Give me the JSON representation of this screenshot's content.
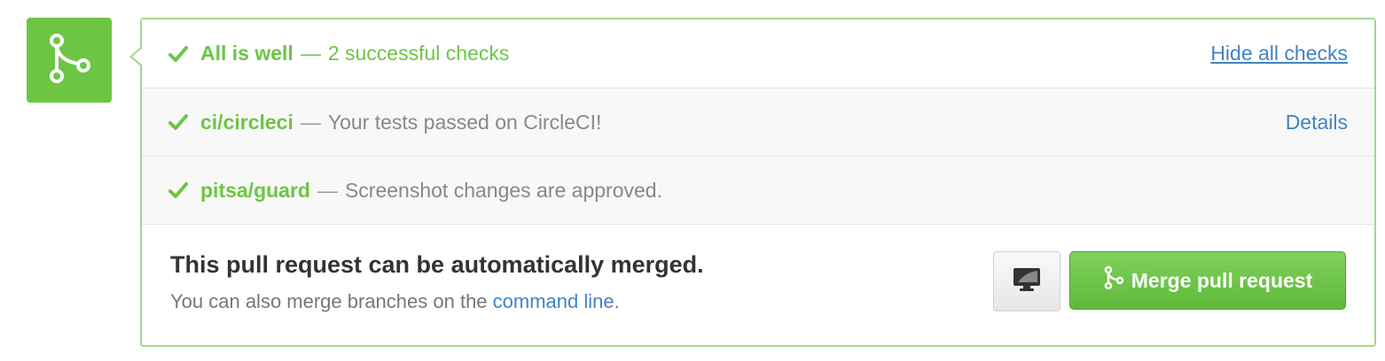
{
  "summary": {
    "headline": "All is well",
    "separator": "—",
    "count_text": "2 successful checks",
    "toggle_link": "Hide all checks"
  },
  "checks": [
    {
      "name": "ci/circleci",
      "separator": "—",
      "description": "Your tests passed on CircleCI!",
      "link": "Details"
    },
    {
      "name": "pitsa/guard",
      "separator": "—",
      "description": "Screenshot changes are approved.",
      "link": ""
    }
  ],
  "merge": {
    "title": "This pull request can be automatically merged.",
    "sub_prefix": "You can also merge branches on the ",
    "sub_link": "command line",
    "sub_suffix": ".",
    "button_label": "Merge pull request"
  },
  "icons": {
    "status": "merge-icon",
    "check": "checkmark-icon",
    "monitor": "desktop-monitor-icon"
  },
  "colors": {
    "success_green": "#6cc644",
    "link_blue": "#4183c4",
    "border_green": "#a3d88e"
  }
}
